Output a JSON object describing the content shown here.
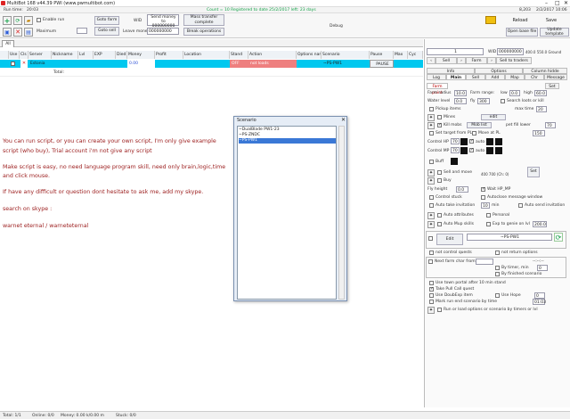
{
  "window": {
    "title": "MultiBot 168 v44.39 PWI (www.pwmultibot.com)"
  },
  "topbar": {
    "run_time_label": "Run time:",
    "run_time_value": "20:03",
    "count_text": "Count = 10  Registered to date 25/2/2017 left: 23 days",
    "right_value": "8,203",
    "right_date": "2/2/2017 10:06"
  },
  "toolbar": {
    "enable_run_label": "Enable run",
    "maximum_label": "Maximum",
    "goto_farm": "Goto farm",
    "goto_sell": "Goto sell",
    "wid_label": "WID",
    "send_money_label": "Send money to",
    "send_money_value": "000000000",
    "leave_money_label": "Leave money",
    "leave_money_value": "000000000",
    "mass_transfer": "Mass transfer complete",
    "break_operations": "Break operations",
    "debug_label": "Debug",
    "reload": "Reload",
    "save": "Save",
    "open_base_file": "Open base file",
    "update_template": "Update template"
  },
  "tabs": {
    "all": "All"
  },
  "table": {
    "headers": [
      "",
      "Use",
      "Cls",
      "Server",
      "Nickname",
      "Lvl",
      "EXP",
      "Died",
      "Money",
      "Profit",
      "Location",
      "Stand",
      "Action",
      "Options name",
      "Scenario",
      "Pause",
      "Max",
      "Cyc"
    ],
    "row1": {
      "server": "Estonia",
      "money": "0.00",
      "stand": "OFF",
      "action": "not loads",
      "scenario": "~PS-PW1",
      "pause": "PAUSE"
    },
    "row2": {
      "nickname": "Total:"
    }
  },
  "messages": [
    "You can run script, or you can create your own script, I'm only give example",
    "script (who buy), Trial account i'm not give any script",
    "Make script is easy, no need language program skill, need only brain,logic,time",
    "and  click mouse.",
    "If have any difficult or question dont hesitate to ask me, add my skype.",
    "search on skype :",
    "warnet eternal / warneteternal"
  ],
  "scenario_dialog": {
    "title": "Scenario",
    "items": [
      "~DualBlade PW1-23",
      "~PS-ZNDC",
      "~PS-PW1"
    ],
    "selected_index": 2
  },
  "right_panel": {
    "count_field": "1",
    "wid_label": "WID",
    "wid_value": "000000000",
    "coords": "400.0 550.0 Ground",
    "tabs_row1": [
      "Sell",
      "Farm",
      "Sell to traders"
    ],
    "tabs_row2": [
      "Info",
      "Options",
      "Column hidde"
    ],
    "tabs_row3": [
      "Log",
      "Main",
      "Sell",
      "Add",
      "Map",
      "Chr",
      "Message"
    ],
    "subtab_left": "Farm point",
    "subtab_right": "Set",
    "farm_radius_label": "Farm radius",
    "farm_radius": "10.0",
    "farm_range_label": "Farm range:",
    "low_label": "low",
    "low_value": "0.0",
    "high_label": "high",
    "high_value": "60.0",
    "water_level_label": "Water level",
    "water_level": "0.0",
    "fly_label": "fly",
    "fly_value": "300",
    "search_loots": "Search loots or kill",
    "pickup_items": "Pickup items",
    "max_time_label": "max time",
    "max_time_value": "20",
    "mines": "Mines",
    "edit_label": "edit",
    "kill_mobs": "Kill mobs",
    "mob_list": "Mob list",
    "pet_fill_label": "pet fill lower",
    "pet_fill_value": "70",
    "set_target_pl": "Set target from PL",
    "move_at_pl": "Move at PL",
    "max_time2_value": "150",
    "control_hp": "Control HP",
    "control_hp_value": "70",
    "control_mp": "Control MP",
    "control_mp_value": "70",
    "auto_label": "auto",
    "buff_label": "Buff",
    "sell_and_move": "Sell and move",
    "sell_info": "400 700 (Ch: 0)",
    "buy_label": "Buy",
    "set_button": "Set",
    "fly_height_label": "Fly height",
    "fly_height": "0.0",
    "wait_hp_mp": "Wait HP_MP",
    "control_stuck": "Control stuck",
    "autoclose_msg": "Autoclose message window",
    "auto_take_invitation": "Auto take invitation",
    "inv_value": "10",
    "min_label": "min",
    "auto_send_invitation": "Auto send invitation",
    "auto_attributes": "Auto attributes",
    "personal": "Personal",
    "auto_mup_skills": "Auto Mup skills",
    "exp_to_genie": "Exp to genie on lvl",
    "exp_value": "200.0",
    "edit_button": "Edit",
    "scenario_value": "~PS-PW1",
    "not_control_quests": "not control quests",
    "not_return_options": "not return options",
    "next_farm_label": "Next farm char from group",
    "dashes": "--:--:--",
    "by_timer_label": "By timer, min",
    "by_timer_value": "0",
    "by_finished": "By finished scenario",
    "use_town_portal": "Use town portal after 10 min stand",
    "take_pet_quest": "Take Pull Call quest",
    "use_double_exp": "Use DoubExp item",
    "use_hope": "Use Hope",
    "hope_value": "0",
    "mark_run": "Mark run end scenario by time",
    "mark_time": "01:03",
    "run_or_load": "Run or load options or scenario by timers or lvl"
  },
  "statusbar": {
    "total": "Total: 1/1",
    "online": "Online: 0/0",
    "money": "Money: 0.00 k/0.00 m",
    "stuck": "Stuck: 0/0"
  },
  "colors": {
    "row_selected": "#00c8ef",
    "off_cell": "#ee7f7f",
    "message": "#9b1c1c"
  }
}
